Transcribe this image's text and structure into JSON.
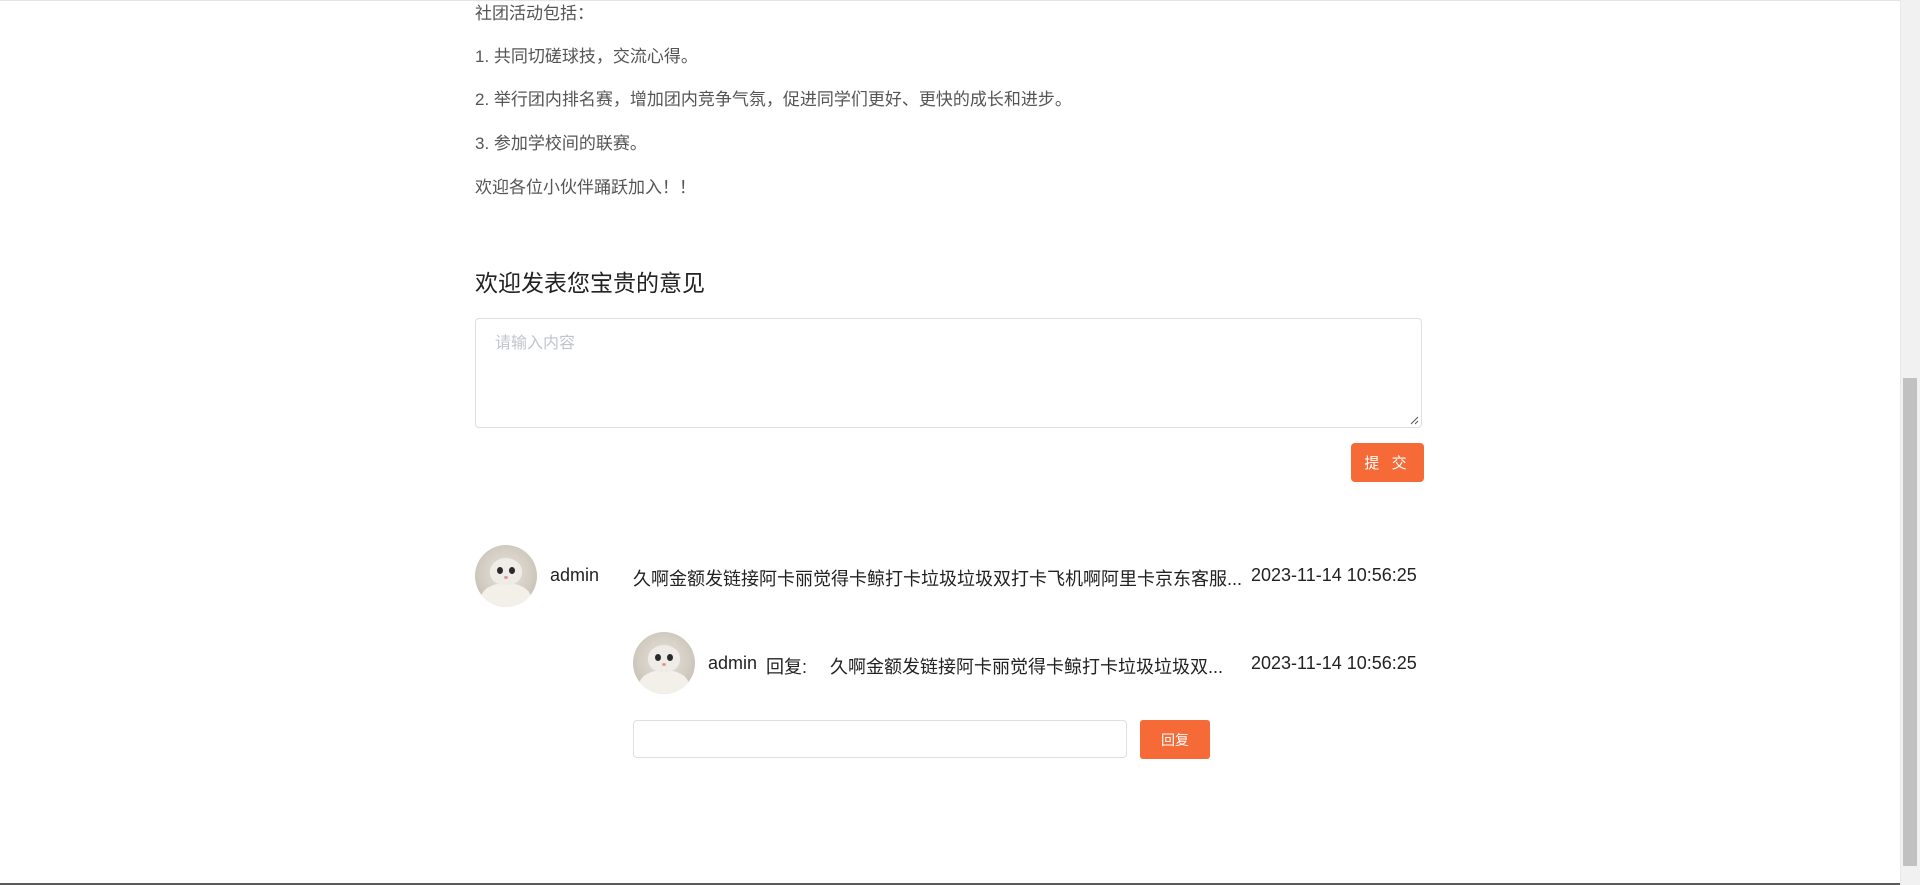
{
  "intro": {
    "lines": [
      "社团活动包括：",
      "1. 共同切磋球技，交流心得。",
      "2. 举行团内排名赛，增加团内竞争气氛，促进同学们更好、更快的成长和进步。",
      "3. 参加学校间的联赛。",
      "欢迎各位小伙伴踊跃加入！！"
    ]
  },
  "feedback": {
    "title": "欢迎发表您宝贵的意见",
    "placeholder": "请输入内容",
    "submit_label": "提 交"
  },
  "comments": [
    {
      "username": "admin",
      "text": "久啊金额发链接阿卡丽觉得卡鲸打卡垃圾垃圾双打卡飞机啊阿里卡京东客服...",
      "time": "2023-11-14 10:56:25",
      "replies": [
        {
          "username": "admin",
          "reply_prefix": "回复:",
          "text": "久啊金额发链接阿卡丽觉得卡鲸打卡垃圾垃圾双...",
          "time": "2023-11-14 10:56:25"
        }
      ],
      "reply_input_value": "",
      "reply_button_label": "回复"
    }
  ],
  "colors": {
    "accent": "#f56a37",
    "text": "#222222",
    "muted": "#555555",
    "border": "#dcdfe6"
  }
}
